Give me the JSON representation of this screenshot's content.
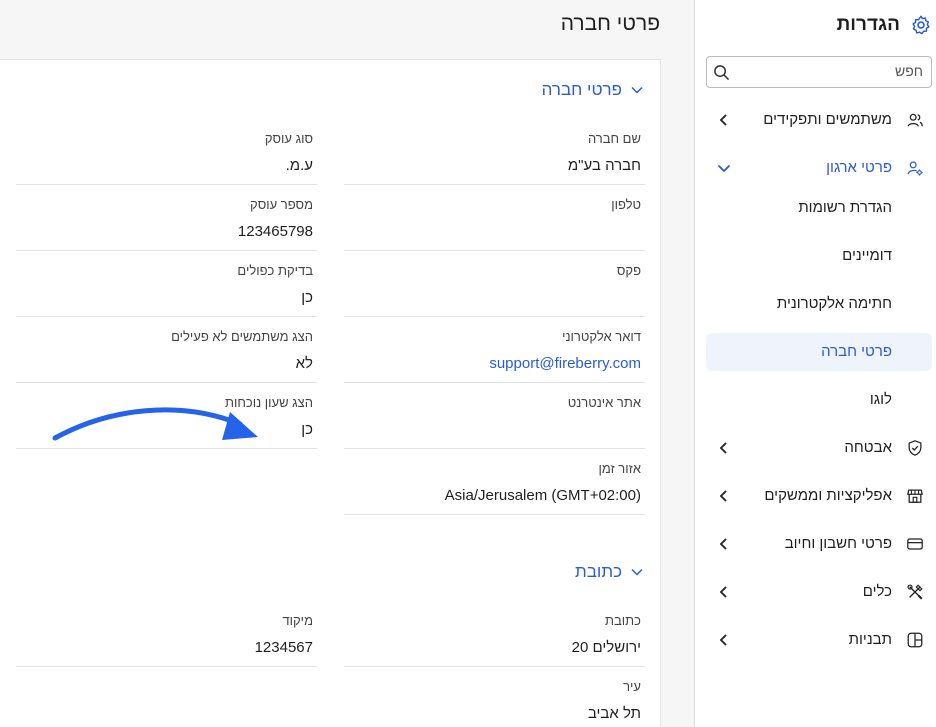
{
  "main": {
    "page_title": "פרטי חברה",
    "sections": {
      "company": {
        "title": "פרטי חברה"
      },
      "address": {
        "title": "כתובת"
      }
    },
    "fields": {
      "company_name": {
        "label": "שם חברה",
        "value": "חברה בע\"מ"
      },
      "business_type": {
        "label": "סוג עוסק",
        "value": "ע.מ."
      },
      "phone": {
        "label": "טלפון",
        "value": ""
      },
      "business_number": {
        "label": "מספר עוסק",
        "value": "123465798"
      },
      "fax": {
        "label": "פקס",
        "value": ""
      },
      "duplicate_check": {
        "label": "בדיקת כפולים",
        "value": "כן"
      },
      "email": {
        "label": "דואר אלקטרוני",
        "value": "support@fireberry.com"
      },
      "show_inactive_users": {
        "label": "הצג משתמשים לא פעילים",
        "value": "לא"
      },
      "website": {
        "label": "אתר אינטרנט",
        "value": ""
      },
      "show_presence_clock": {
        "label": "הצג שעון נוכחות",
        "value": "כן"
      },
      "timezone": {
        "label": "אזור זמן",
        "value": "Asia/Jerusalem (GMT+02:00)"
      },
      "address": {
        "label": "כתובת",
        "value": "ירושלים 20"
      },
      "zip": {
        "label": "מיקוד",
        "value": "1234567"
      },
      "city": {
        "label": "עיר",
        "value": "תל אביב"
      }
    },
    "colors": {
      "accent": "#2a5bd7",
      "arrow": "#2563eb"
    }
  },
  "sidebar": {
    "title": "הגדרות",
    "title_icon": "gear-icon",
    "search_placeholder": "חפש",
    "items": [
      {
        "label": "משתמשים ותפקידים",
        "icon": "users-icon",
        "expanded": false
      },
      {
        "label": "פרטי ארגון",
        "icon": "org-settings-icon",
        "expanded": true,
        "children": [
          {
            "label": "הגדרת רשומות"
          },
          {
            "label": "דומיינים"
          },
          {
            "label": "חתימה אלקטרונית"
          },
          {
            "label": "פרטי חברה",
            "selected": true
          },
          {
            "label": "לוגו"
          }
        ]
      },
      {
        "label": "אבטחה",
        "icon": "shield-icon",
        "expanded": false
      },
      {
        "label": "אפליקציות וממשקים",
        "icon": "store-icon",
        "expanded": false
      },
      {
        "label": "פרטי חשבון וחיוב",
        "icon": "credit-card-icon",
        "expanded": false
      },
      {
        "label": "כלים",
        "icon": "tools-icon",
        "expanded": false
      },
      {
        "label": "תבניות",
        "icon": "templates-icon",
        "expanded": false
      }
    ]
  }
}
